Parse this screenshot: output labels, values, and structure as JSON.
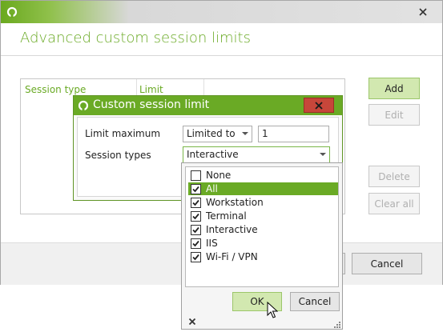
{
  "main_window": {
    "title": "Advanced custom session limits",
    "table": {
      "columns": [
        "Session type",
        "Limit"
      ]
    },
    "buttons": {
      "add": "Add",
      "edit": "Edit",
      "delete": "Delete",
      "clear_all": "Clear all"
    },
    "footer": {
      "cancel": "Cancel"
    }
  },
  "dialog": {
    "title": "Custom session limit",
    "limit_maximum_label": "Limit maximum",
    "limit_mode_value": "Limited to",
    "limit_value": "1",
    "session_types_label": "Session types",
    "session_types_value": "Interactive"
  },
  "dropdown": {
    "options": [
      {
        "label": "None",
        "checked": false,
        "highlighted": false
      },
      {
        "label": "All",
        "checked": true,
        "highlighted": true
      },
      {
        "label": "Workstation",
        "checked": true,
        "highlighted": false
      },
      {
        "label": "Terminal",
        "checked": true,
        "highlighted": false
      },
      {
        "label": "Interactive",
        "checked": true,
        "highlighted": false
      },
      {
        "label": "IIS",
        "checked": true,
        "highlighted": false
      },
      {
        "label": "Wi-Fi / VPN",
        "checked": true,
        "highlighted": false
      }
    ],
    "ok": "OK",
    "cancel": "Cancel"
  },
  "colors": {
    "accent": "#6aaa25",
    "primary_button_bg": "#d2e8b0",
    "close_button": "#c7463a"
  },
  "icons": [
    "app-logo-icon",
    "close-icon",
    "dialog-close-icon",
    "chevron-down-icon",
    "checkbox-icon",
    "resize-grip-icon",
    "mouse-cursor-icon"
  ]
}
